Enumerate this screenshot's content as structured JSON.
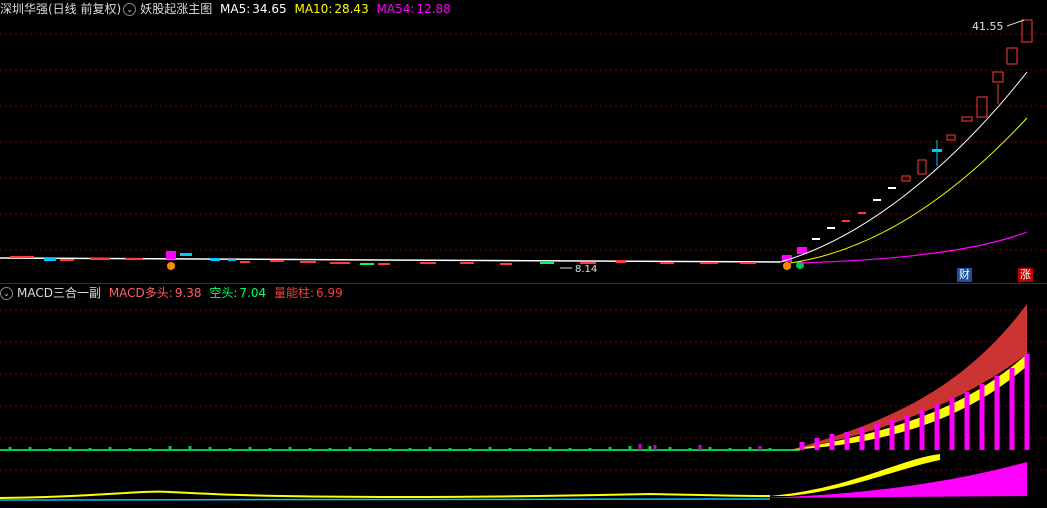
{
  "main_header": {
    "stock": "深圳华强(日线 前复权)",
    "indicator": "妖股起涨主图",
    "ma5_label": "MA5:",
    "ma5_value": "34.65",
    "ma10_label": "MA10:",
    "ma10_value": "28.43",
    "ma54_label": "MA54:",
    "ma54_value": "12.88"
  },
  "main_chart": {
    "high_label": "41.55",
    "low_label": "8.14",
    "badge_cai": "财",
    "badge_zhang": "涨"
  },
  "sub_header": {
    "indicator": "MACD三合一副",
    "macd_bull_label": "MACD多头:",
    "macd_bull_value": "9.38",
    "bear_label": "空头:",
    "bear_value": "7.04",
    "volume_label": "量能柱:",
    "volume_value": "6.99"
  },
  "colors": {
    "background": "#000000",
    "grid": "#8b0000",
    "up_candle": "#ff3b3b",
    "down_candle": "#00c8ff",
    "ma5": "#ffffff",
    "ma10": "#ffff00",
    "ma54": "#ff00ff",
    "macd_fill": "#ff3333",
    "bear_fill": "#ffff00",
    "volume_bars": "#ff00ff"
  }
}
